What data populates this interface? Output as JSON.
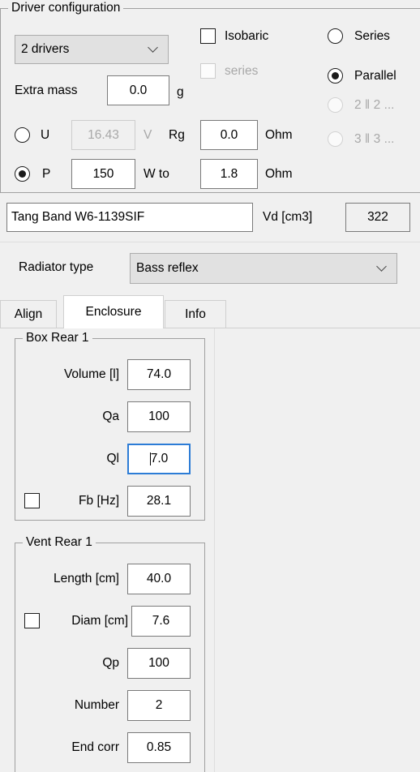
{
  "driver_config": {
    "group_title": "Driver configuration",
    "drivers_select": {
      "value": "2 drivers"
    },
    "extra_mass": {
      "label": "Extra mass",
      "value": "0.0",
      "unit": "g"
    },
    "isobaric": {
      "label": "Isobaric",
      "checked": false
    },
    "isobaric_series": {
      "label": "series",
      "checked": false,
      "enabled": false
    },
    "wiring": {
      "series": "Series",
      "parallel": "Parallel",
      "two_by_two": "2 ‖ 2 ...",
      "three_by_three": "3 ‖ 3 ...",
      "selected": "Parallel"
    },
    "drive": {
      "u_label": "U",
      "u_value": "16.43",
      "u_unit": "V",
      "rg_label": "Rg",
      "rg_value": "0.0",
      "rg_unit": "Ohm",
      "p_label": "P",
      "p_value": "150",
      "p_unit": "W to",
      "p_load_value": "1.8",
      "p_load_unit": "Ohm",
      "selected": "P"
    }
  },
  "driver": {
    "name": "Tang Band W6-1139SIF",
    "vd_label": "Vd [cm3]",
    "vd_value": "322"
  },
  "radiator": {
    "label": "Radiator type",
    "value": "Bass reflex"
  },
  "tabs": {
    "items": [
      {
        "label": "Align",
        "selected": false
      },
      {
        "label": "Enclosure",
        "selected": true
      },
      {
        "label": "Info",
        "selected": false
      }
    ]
  },
  "box_rear": {
    "group_title": "Box Rear 1",
    "volume": {
      "label": "Volume [l]",
      "value": "74.0"
    },
    "qa": {
      "label": "Qa",
      "value": "100"
    },
    "ql": {
      "label": "Ql",
      "value": "7.0",
      "focused": true
    },
    "fb": {
      "label": "Fb [Hz]",
      "value": "28.1",
      "checked": false
    }
  },
  "vent_rear": {
    "group_title": "Vent Rear 1",
    "length": {
      "label": "Length [cm]",
      "value": "40.0"
    },
    "diam": {
      "label": "Diam [cm]",
      "value": "7.6",
      "checked": false
    },
    "qp": {
      "label": "Qp",
      "value": "100"
    },
    "number": {
      "label": "Number",
      "value": "2"
    },
    "end_corr": {
      "label": "End corr",
      "value": "0.85"
    }
  },
  "colors": {
    "background": "#f0f0f0",
    "focus_accent": "#2c7cd6",
    "field_border": "#7a7a7a",
    "disabled_text": "#a8a8a8"
  }
}
